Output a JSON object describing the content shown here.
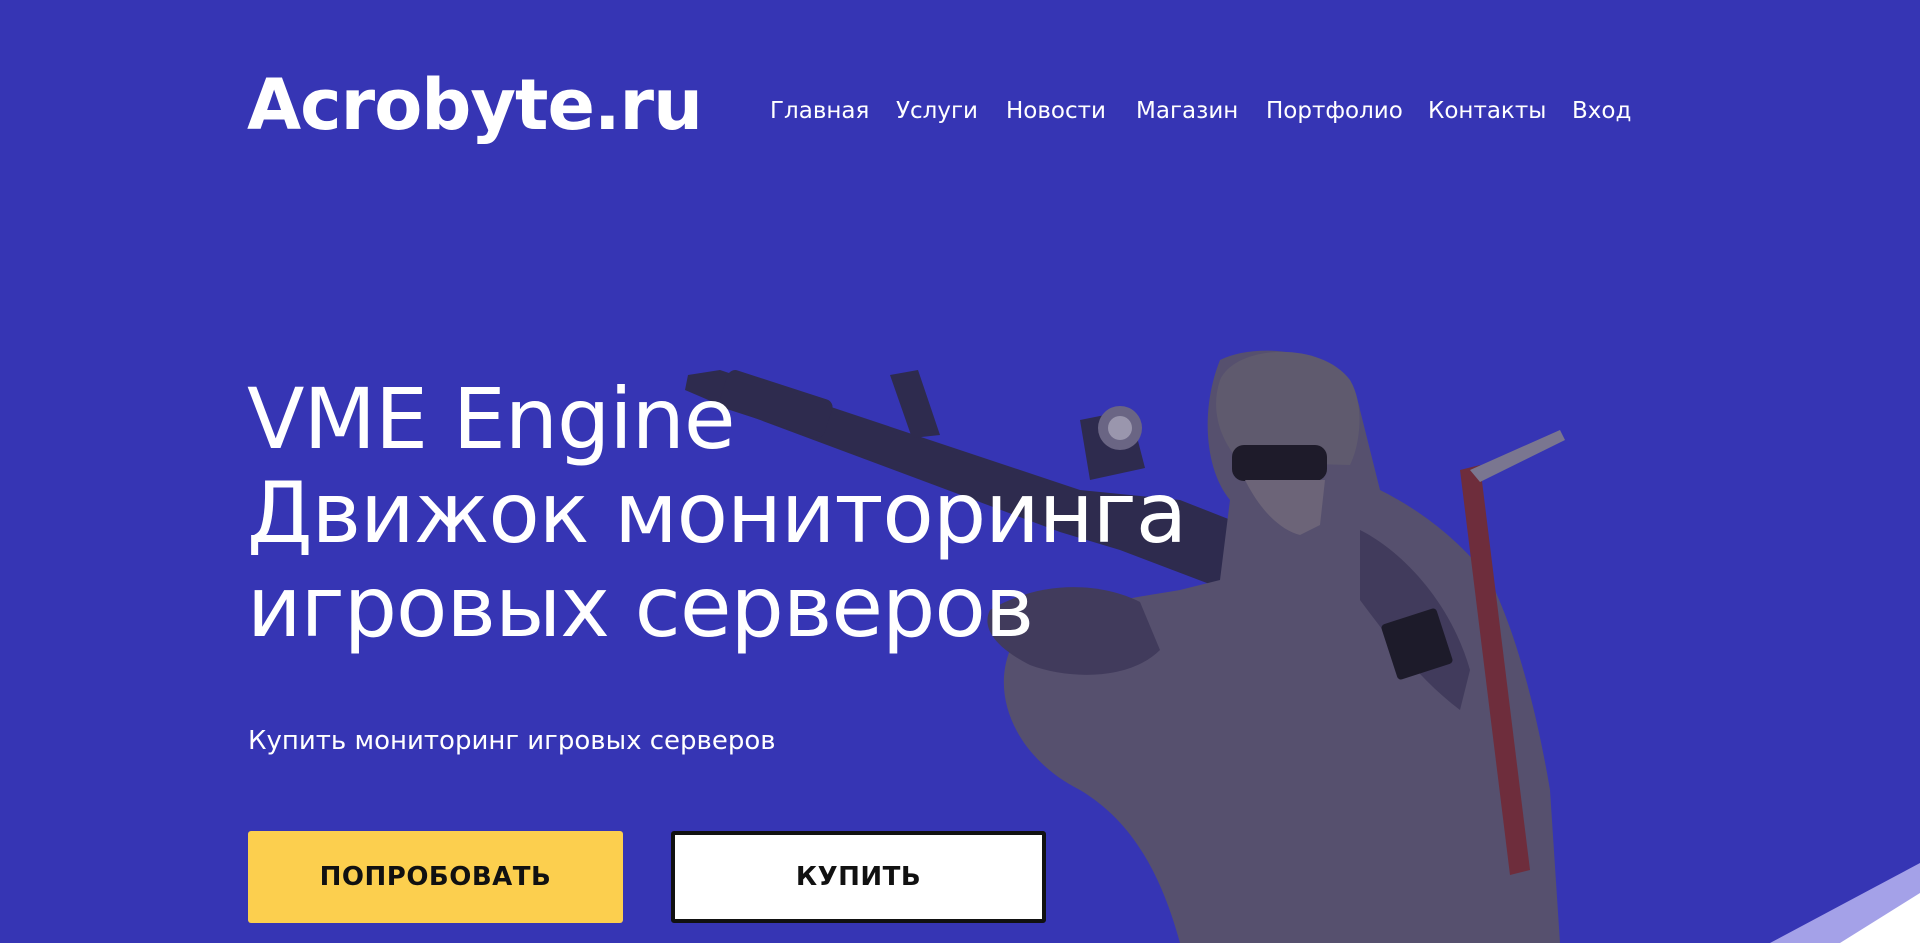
{
  "header": {
    "logo": "Acrobyte.ru",
    "nav": [
      {
        "label": "Главная"
      },
      {
        "label": "Услуги"
      },
      {
        "label": "Новости"
      },
      {
        "label": "Магазин"
      },
      {
        "label": "Портфолио"
      },
      {
        "label": "Контакты"
      },
      {
        "label": "Вход"
      }
    ]
  },
  "hero": {
    "title_lines": [
      "VME Engine",
      "Движок мониторинга",
      "игровых серверов"
    ],
    "subtitle": "Купить мониторинг игровых серверов",
    "buttons": {
      "try_label": "ПОПРОБОВАТЬ",
      "buy_label": "КУПИТЬ"
    }
  },
  "colors": {
    "background": "#3635b4",
    "accent_yellow": "#fccf4e",
    "text": "#ffffff",
    "button_text": "#111111"
  }
}
